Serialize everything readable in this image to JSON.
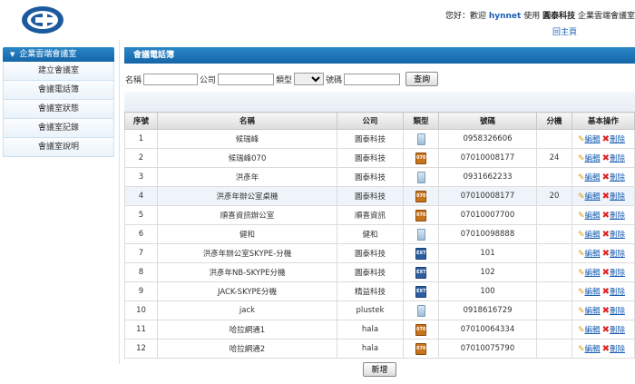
{
  "header": {
    "greeting_prefix": "您好：歡迎",
    "username": "hynnet",
    "use_text": "使用",
    "company": "圓泰科技",
    "product": "企業雲端會議室",
    "home_link": "回主頁"
  },
  "sidebar": {
    "title": "企業雲端會議室",
    "items": [
      {
        "label": "建立會議室"
      },
      {
        "label": "會議電話簿"
      },
      {
        "label": "會議室狀態"
      },
      {
        "label": "會議室記錄"
      },
      {
        "label": "會議室說明"
      }
    ]
  },
  "main": {
    "title": "會議電話簿",
    "search": {
      "name_label": "名稱",
      "company_label": "公司",
      "type_label": "類型",
      "number_label": "號碼",
      "query_button": "查詢",
      "name_value": "",
      "company_value": "",
      "number_value": "",
      "type_value": ""
    },
    "table": {
      "headers": [
        "序號",
        "名稱",
        "公司",
        "類型",
        "號碼",
        "分機",
        "基本操作"
      ],
      "rows": [
        {
          "no": "1",
          "name": "候瑞峰",
          "company": "圓泰科技",
          "type": "phone",
          "number": "0958326606",
          "ext": ""
        },
        {
          "no": "2",
          "name": "候瑞峰070",
          "company": "圓泰科技",
          "type": "070",
          "number": "07010008177",
          "ext": "24"
        },
        {
          "no": "3",
          "name": "洪彥年",
          "company": "圓泰科技",
          "type": "phone",
          "number": "0931662233",
          "ext": ""
        },
        {
          "no": "4",
          "name": "洪彥年辦公室桌機",
          "company": "圓泰科技",
          "type": "070",
          "number": "07010008177",
          "ext": "20"
        },
        {
          "no": "5",
          "name": "順喜資訊辦公室",
          "company": "順喜資訊",
          "type": "070",
          "number": "07010007700",
          "ext": ""
        },
        {
          "no": "6",
          "name": "健和",
          "company": "健和",
          "type": "phone",
          "number": "07010098888",
          "ext": ""
        },
        {
          "no": "7",
          "name": "洪彥年辦公室SKYPE-分機",
          "company": "圓泰科技",
          "type": "EXT",
          "number": "101",
          "ext": ""
        },
        {
          "no": "8",
          "name": "洪彥年NB-SKYPE分機",
          "company": "圓泰科技",
          "type": "EXT",
          "number": "102",
          "ext": ""
        },
        {
          "no": "9",
          "name": "JACK-SKYPE分機",
          "company": "精益科技",
          "type": "EXT",
          "number": "100",
          "ext": ""
        },
        {
          "no": "10",
          "name": "jack",
          "company": "plustek",
          "type": "phone",
          "number": "0918616729",
          "ext": ""
        },
        {
          "no": "11",
          "name": "哈拉網通1",
          "company": "hala",
          "type": "070",
          "number": "07010064334",
          "ext": ""
        },
        {
          "no": "12",
          "name": "哈拉網通2",
          "company": "hala",
          "type": "070",
          "number": "07010075790",
          "ext": ""
        }
      ],
      "edit_label": "編輯",
      "delete_label": "刪除"
    },
    "add_button": "新增"
  },
  "icons": {
    "logo": "company-logo",
    "sidebar_arrow": "triangle-down-icon",
    "type_phone": "mobile-phone-icon",
    "type_070": "voip-070-icon",
    "type_ext": "extension-icon",
    "edit": "pencil-icon",
    "delete": "red-x-icon"
  },
  "colors": {
    "accent": "#1a6fb5",
    "link": "#1a5fb4",
    "alt_row": "#eef4fa"
  }
}
